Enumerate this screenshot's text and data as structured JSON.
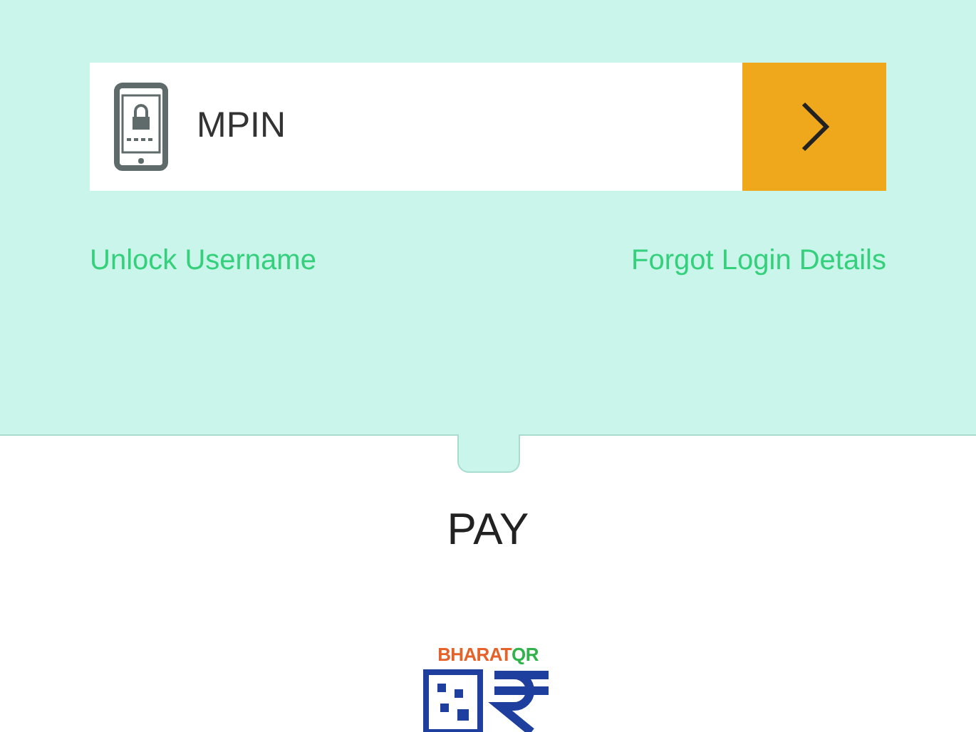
{
  "login": {
    "mpin_field": {
      "placeholder": "MPIN"
    },
    "links": [
      "Unlock Username",
      "Forgot Login Details"
    ]
  },
  "pay_section": {
    "title": "PAY",
    "logo": {
      "word_1": "BHARAT",
      "word_2": "QR"
    }
  }
}
